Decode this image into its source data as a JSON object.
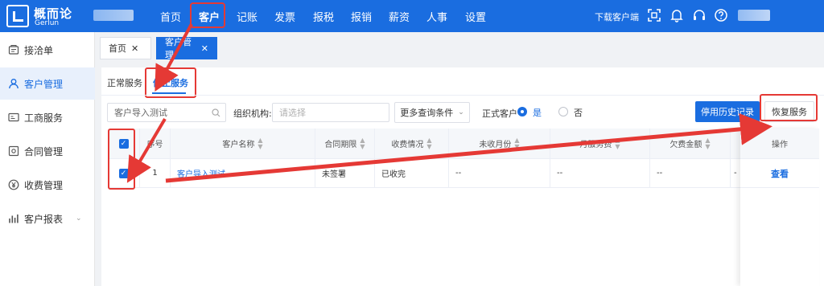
{
  "brand": {
    "name_cn": "概而论",
    "name_en": "Gerlun"
  },
  "topnav": {
    "items": [
      "首页",
      "客户",
      "记账",
      "发票",
      "报税",
      "报销",
      "薪资",
      "人事",
      "设置"
    ],
    "active_index": 1,
    "download_label": "下载客户端",
    "icons": [
      "scan-icon",
      "bell-icon",
      "headset-icon",
      "help-icon"
    ]
  },
  "sidebar": {
    "items": [
      {
        "label": "接洽单",
        "icon": "handshake-icon"
      },
      {
        "label": "客户管理",
        "icon": "user-icon",
        "active": true
      },
      {
        "label": "工商服务",
        "icon": "id-card-icon"
      },
      {
        "label": "合同管理",
        "icon": "contract-icon"
      },
      {
        "label": "收费管理",
        "icon": "yen-icon"
      },
      {
        "label": "客户报表",
        "icon": "chart-icon",
        "has_submenu": true
      }
    ]
  },
  "page_tabs": [
    {
      "label": "首页",
      "close": "✕"
    },
    {
      "label": "客户管理",
      "close": "✕",
      "active": true
    }
  ],
  "service_tabs": {
    "normal": "正常服务",
    "stopped": "停止服务",
    "active": "stopped"
  },
  "filters": {
    "search_value": "客户导入测试",
    "org_label": "组织机构:",
    "org_placeholder": "请选择",
    "more_label": "更多查询条件",
    "formal_label": "正式客户",
    "yes_label": "是",
    "no_label": "否",
    "selected": "yes"
  },
  "buttons": {
    "history": "停用历史记录",
    "restore": "恢复服务"
  },
  "table": {
    "headers": [
      "序号",
      "客户名称",
      "合同期限",
      "收费情况",
      "未收月份",
      "月服务费",
      "欠费金额",
      "",
      "操作"
    ],
    "rows": [
      {
        "index": "1",
        "name": "客户导入测试",
        "contract": "未签署",
        "fee_status": "已收完",
        "unpaid_months": "--",
        "monthly_fee": "--",
        "arrears": "--",
        "extra": "-",
        "action": "查看"
      }
    ]
  },
  "colors": {
    "primary": "#1a6de0",
    "annotation": "#e53935"
  }
}
